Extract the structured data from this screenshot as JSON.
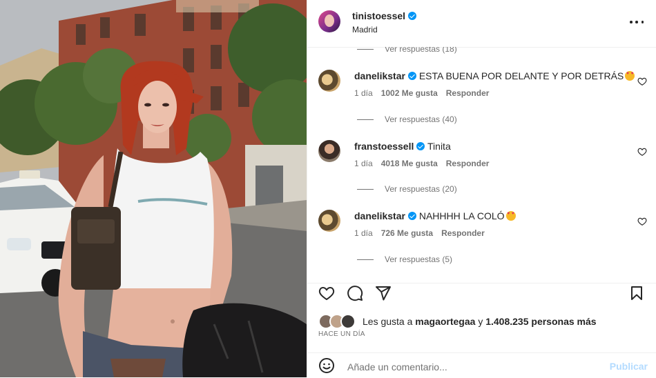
{
  "post": {
    "username": "tinistoessel",
    "location": "Madrid"
  },
  "comments": {
    "replies_top": "Ver respuestas (18)",
    "items": [
      {
        "user": "danelikstar",
        "text": "ESTA BUENA POR DELANTE Y POR DETRÁS",
        "emoji": "heart-eyes",
        "time": "1 día",
        "likes": "1002 Me gusta",
        "reply": "Responder",
        "replies": "Ver respuestas (40)"
      },
      {
        "user": "franstoessell",
        "text": "Tinita",
        "time": "1 día",
        "likes": "4018 Me gusta",
        "reply": "Responder",
        "replies": "Ver respuestas (20)"
      },
      {
        "user": "danelikstar",
        "text": "NAHHHH LA COLÓ",
        "emoji": "heart-eyes",
        "time": "1 día",
        "likes": "726 Me gusta",
        "reply": "Responder",
        "replies": "Ver respuestas (5)"
      }
    ]
  },
  "likes": {
    "prefix": "Les gusta a",
    "user": "magaortegaa",
    "middle": "y",
    "count": "1.408.235 personas más"
  },
  "timestamp": "HACE UN DÍA",
  "add_comment": {
    "placeholder": "Añade un comentario...",
    "publish": "Publicar"
  },
  "colors": {
    "verified": "#0095f6",
    "muted": "#737373",
    "publish_disabled": "#b3dbff"
  },
  "icons": [
    "more-icon",
    "heart-icon",
    "comment-icon",
    "share-icon",
    "bookmark-icon",
    "emoji-icon",
    "verified-icon"
  ]
}
